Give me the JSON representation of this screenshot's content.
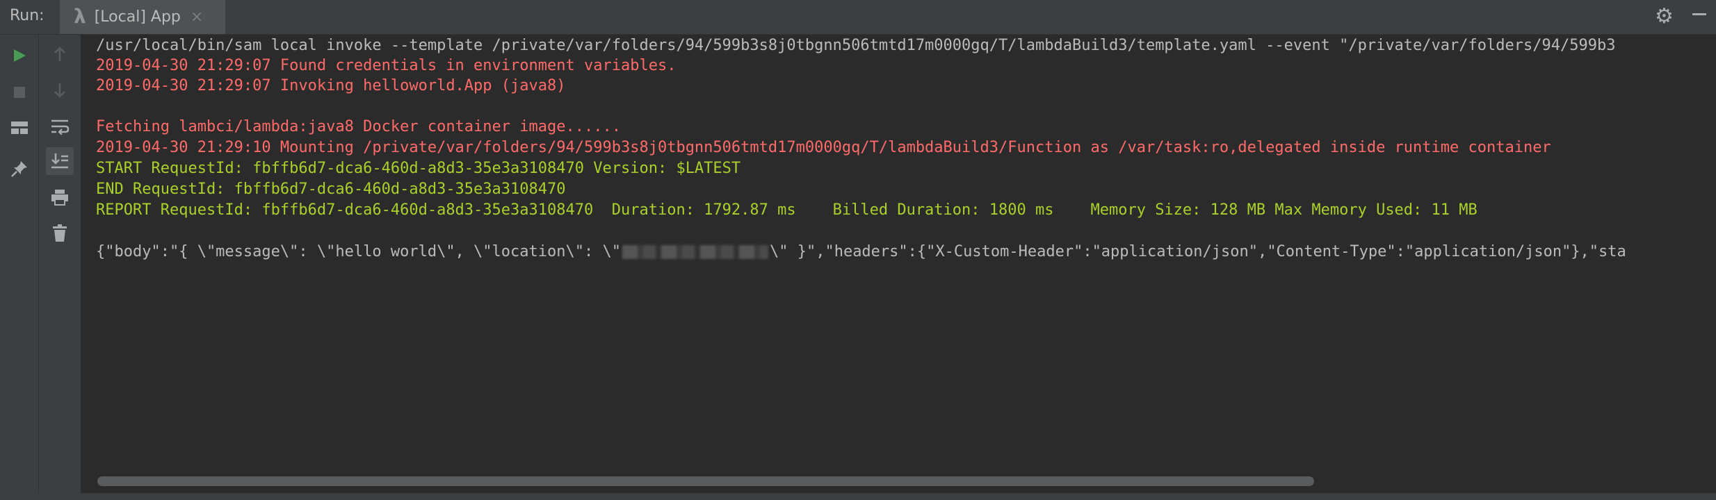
{
  "header": {
    "run_label": "Run:",
    "tab": {
      "icon": "lambda-icon",
      "label": "[Local] App"
    }
  },
  "toolbar": {
    "icons": [
      "run-icon",
      "stop-icon",
      "layout-icon",
      "pin-icon",
      "up-arrow-icon",
      "down-arrow-icon",
      "soft-wrap-icon",
      "scroll-to-end-icon",
      "print-icon",
      "trash-icon"
    ]
  },
  "console": {
    "line1": "/usr/local/bin/sam local invoke --template /private/var/folders/94/599b3s8j0tbgnn506tmtd17m0000gq/T/lambdaBuild3/template.yaml --event \"/private/var/folders/94/599b3",
    "line2": "2019-04-30 21:29:07 Found credentials in environment variables.",
    "line3": "2019-04-30 21:29:07 Invoking helloworld.App (java8)",
    "line4": "Fetching lambci/lambda:java8 Docker container image......",
    "line5": "2019-04-30 21:29:10 Mounting /private/var/folders/94/599b3s8j0tbgnn506tmtd17m0000gq/T/lambdaBuild3/Function as /var/task:ro,delegated inside runtime container",
    "line6": "START RequestId: fbffb6d7-dca6-460d-a8d3-35e3a3108470 Version: $LATEST",
    "line7": "END RequestId: fbffb6d7-dca6-460d-a8d3-35e3a3108470",
    "line8": "REPORT RequestId: fbffb6d7-dca6-460d-a8d3-35e3a3108470  Duration: 1792.87 ms    Billed Duration: 1800 ms    Memory Size: 128 MB Max Memory Used: 11 MB",
    "line9_start": "{\"body\":\"{ \\\"message\\\": \\\"hello world\\\", \\\"location\\\": \\\"",
    "line9_end": "\\\" }\",\"headers\":{\"X-Custom-Header\":\"application/json\",\"Content-Type\":\"application/json\"},\"sta"
  },
  "colors": {
    "background": "#2b2b2b",
    "panel": "#3c3f41",
    "text_default": "#bbbbbb",
    "text_error": "#ff6b68",
    "text_lime": "#a9d02b",
    "run_green": "#499c54"
  }
}
